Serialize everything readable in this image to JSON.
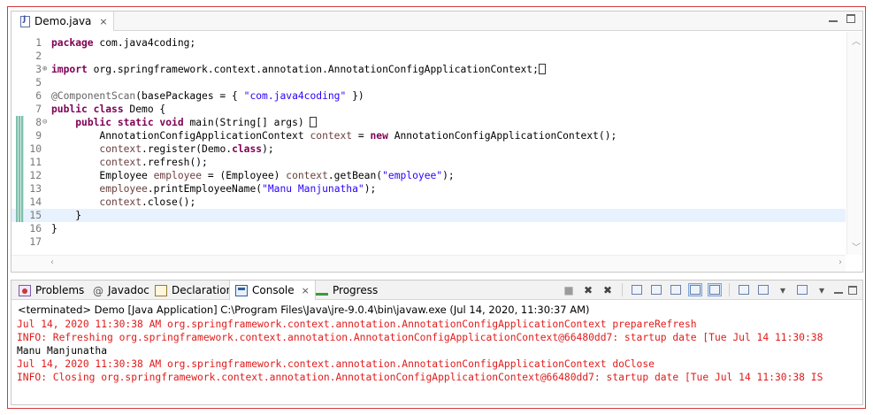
{
  "editor": {
    "tab_label": "Demo.java",
    "tab_close": "⨯",
    "lines": [
      {
        "n": "1",
        "html": "<span class=\"kw\">package</span> com.java4coding;"
      },
      {
        "n": "2",
        "html": ""
      },
      {
        "n": "3",
        "fold": "⊕",
        "html": "<span class=\"kw\">import</span> org.springframework.context.annotation.AnnotationConfigApplicationContext;<span class=\"cursorbox\"></span>"
      },
      {
        "n": "5",
        "html": ""
      },
      {
        "n": "6",
        "html": "<span class=\"ann\">@ComponentScan</span>(basePackages = { <span class=\"str\">\"com.java4coding\"</span> })"
      },
      {
        "n": "7",
        "html": "<span class=\"kw\">public class</span> Demo {"
      },
      {
        "n": "8",
        "fold": "⊖",
        "mark": true,
        "html": "    <span class=\"kw\">public static void</span> main(String[] args) <span class=\"cursorbox\"></span>"
      },
      {
        "n": "9",
        "mark": true,
        "html": "        AnnotationConfigApplicationContext <span class=\"var\">context</span> = <span class=\"kw\">new</span> AnnotationConfigApplicationContext();"
      },
      {
        "n": "10",
        "mark": true,
        "html": "        <span class=\"var\">context</span>.register(Demo.<span class=\"kw\">class</span>);"
      },
      {
        "n": "11",
        "mark": true,
        "html": "        <span class=\"var\">context</span>.refresh();"
      },
      {
        "n": "12",
        "mark": true,
        "html": "        Employee <span class=\"var\">employee</span> = (Employee) <span class=\"var\">context</span>.getBean(<span class=\"str\">\"employee\"</span>);"
      },
      {
        "n": "13",
        "mark": true,
        "html": "        <span class=\"var\">employee</span>.printEmployeeName(<span class=\"str\">\"Manu Manjunatha\"</span>);"
      },
      {
        "n": "14",
        "mark": true,
        "html": "        <span class=\"var\">context</span>.close();"
      },
      {
        "n": "15",
        "mark": true,
        "current": true,
        "html": "    }"
      },
      {
        "n": "16",
        "html": "}"
      },
      {
        "n": "17",
        "html": ""
      }
    ]
  },
  "panel": {
    "tabs": [
      {
        "label": "Problems",
        "icon": "problems-icon"
      },
      {
        "label": "Javadoc",
        "icon": "javadoc-icon"
      },
      {
        "label": "Declaration",
        "icon": "declaration-icon"
      },
      {
        "label": "Console",
        "icon": "console-icon",
        "active": true
      },
      {
        "label": "Progress",
        "icon": "progress-icon"
      }
    ],
    "console_close": "⨯",
    "terminated_text": "<terminated> Demo [Java Application] C:\\Program Files\\Java\\jre-9.0.4\\bin\\javaw.exe (Jul 14, 2020, 11:30:37 AM)",
    "output": [
      {
        "type": "err",
        "text": "Jul 14, 2020 11:30:38 AM org.springframework.context.annotation.AnnotationConfigApplicationContext prepareRefresh"
      },
      {
        "type": "err",
        "text": "INFO: Refreshing org.springframework.context.annotation.AnnotationConfigApplicationContext@66480dd7: startup date [Tue Jul 14 11:30:38"
      },
      {
        "type": "out",
        "text": "Manu Manjunatha"
      },
      {
        "type": "err",
        "text": "Jul 14, 2020 11:30:38 AM org.springframework.context.annotation.AnnotationConfigApplicationContext doClose"
      },
      {
        "type": "err",
        "text": "INFO: Closing org.springframework.context.annotation.AnnotationConfigApplicationContext@66480dd7: startup date [Tue Jul 14 11:30:38 IS"
      }
    ]
  },
  "colors": {
    "keyword": "#7f0055",
    "string": "#2a00ff",
    "local_variable": "#6a3e3e",
    "annotation": "#646464",
    "console_error": "#e01b1b",
    "current_line": "#e8f2fe"
  }
}
